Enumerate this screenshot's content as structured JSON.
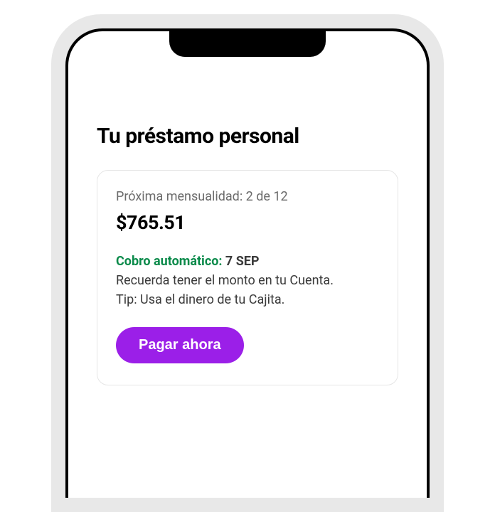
{
  "header": {
    "title": "Tu préstamo personal"
  },
  "loan": {
    "next_payment_label": "Próxima mensualidad: 2 de 12",
    "amount": "$765.51",
    "auto_charge_label": "Cobro automático: ",
    "auto_charge_date": "7 SEP",
    "reminder": "Recuerda tener el monto en tu Cuenta.",
    "tip": "Tip: Usa el dinero de tu Cajita.",
    "pay_button_label": "Pagar ahora"
  }
}
